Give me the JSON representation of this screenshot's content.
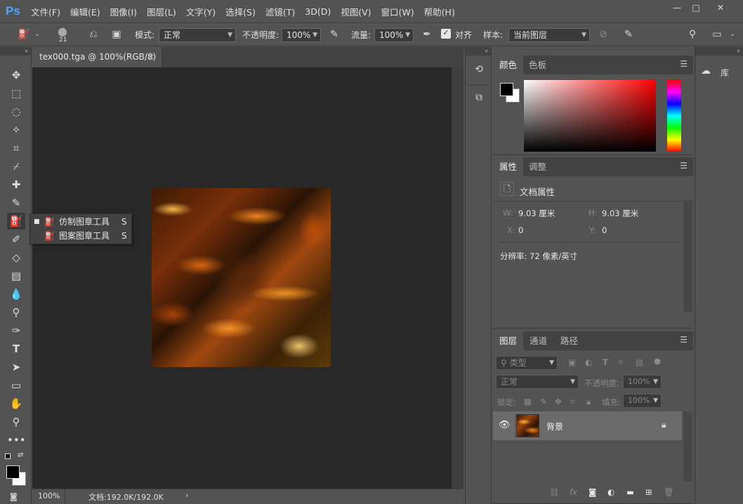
{
  "app": {
    "logo": "Ps"
  },
  "menu": [
    "文件(F)",
    "编辑(E)",
    "图像(I)",
    "图层(L)",
    "文字(Y)",
    "选择(S)",
    "滤镜(T)",
    "3D(D)",
    "视图(V)",
    "窗口(W)",
    "帮助(H)"
  ],
  "options": {
    "brush_size": "21",
    "mode_label": "模式:",
    "mode_value": "正常",
    "opacity_label": "不透明度:",
    "opacity_value": "100%",
    "flow_label": "流量:",
    "flow_value": "100%",
    "aligned_label": "对齐",
    "aligned_checked": true,
    "sample_label": "样本:",
    "sample_value": "当前图层"
  },
  "document": {
    "tab_title": "tex000.tga @ 100%(RGB/8)",
    "close": "×",
    "zoom": "100%",
    "doc_info": "文档:192.0K/192.0K",
    "status_arrow": "›"
  },
  "flyout": {
    "items": [
      {
        "label": "仿制图章工具",
        "shortcut": "S",
        "selected": true
      },
      {
        "label": "图案图章工具",
        "shortcut": "S",
        "selected": false
      }
    ]
  },
  "color_panel": {
    "tabs": [
      "颜色",
      "色板"
    ]
  },
  "properties_panel": {
    "tabs": [
      "属性",
      "调整"
    ],
    "title": "文档属性",
    "w_label": "W:",
    "w_value": "9.03 厘米",
    "h_label": "H:",
    "h_value": "9.03 厘米",
    "x_label": "X:",
    "x_value": "0",
    "y_label": "Y:",
    "y_value": "0",
    "resolution": "分辨率: 72 像素/英寸"
  },
  "layers_panel": {
    "tabs": [
      "图层",
      "通道",
      "路径"
    ],
    "filter_label": "类型",
    "blend_mode": "正常",
    "opacity_label": "不透明度:",
    "opacity_value": "100%",
    "lock_label": "锁定:",
    "fill_label": "填充:",
    "fill_value": "100%",
    "layers": [
      {
        "name": "背景",
        "visible": true,
        "locked": true
      }
    ]
  },
  "libraries": {
    "label": "库"
  },
  "colors": {
    "accent": "#4fa3ff",
    "panel": "#535353",
    "dark": "#424242",
    "canvas": "#282828"
  }
}
